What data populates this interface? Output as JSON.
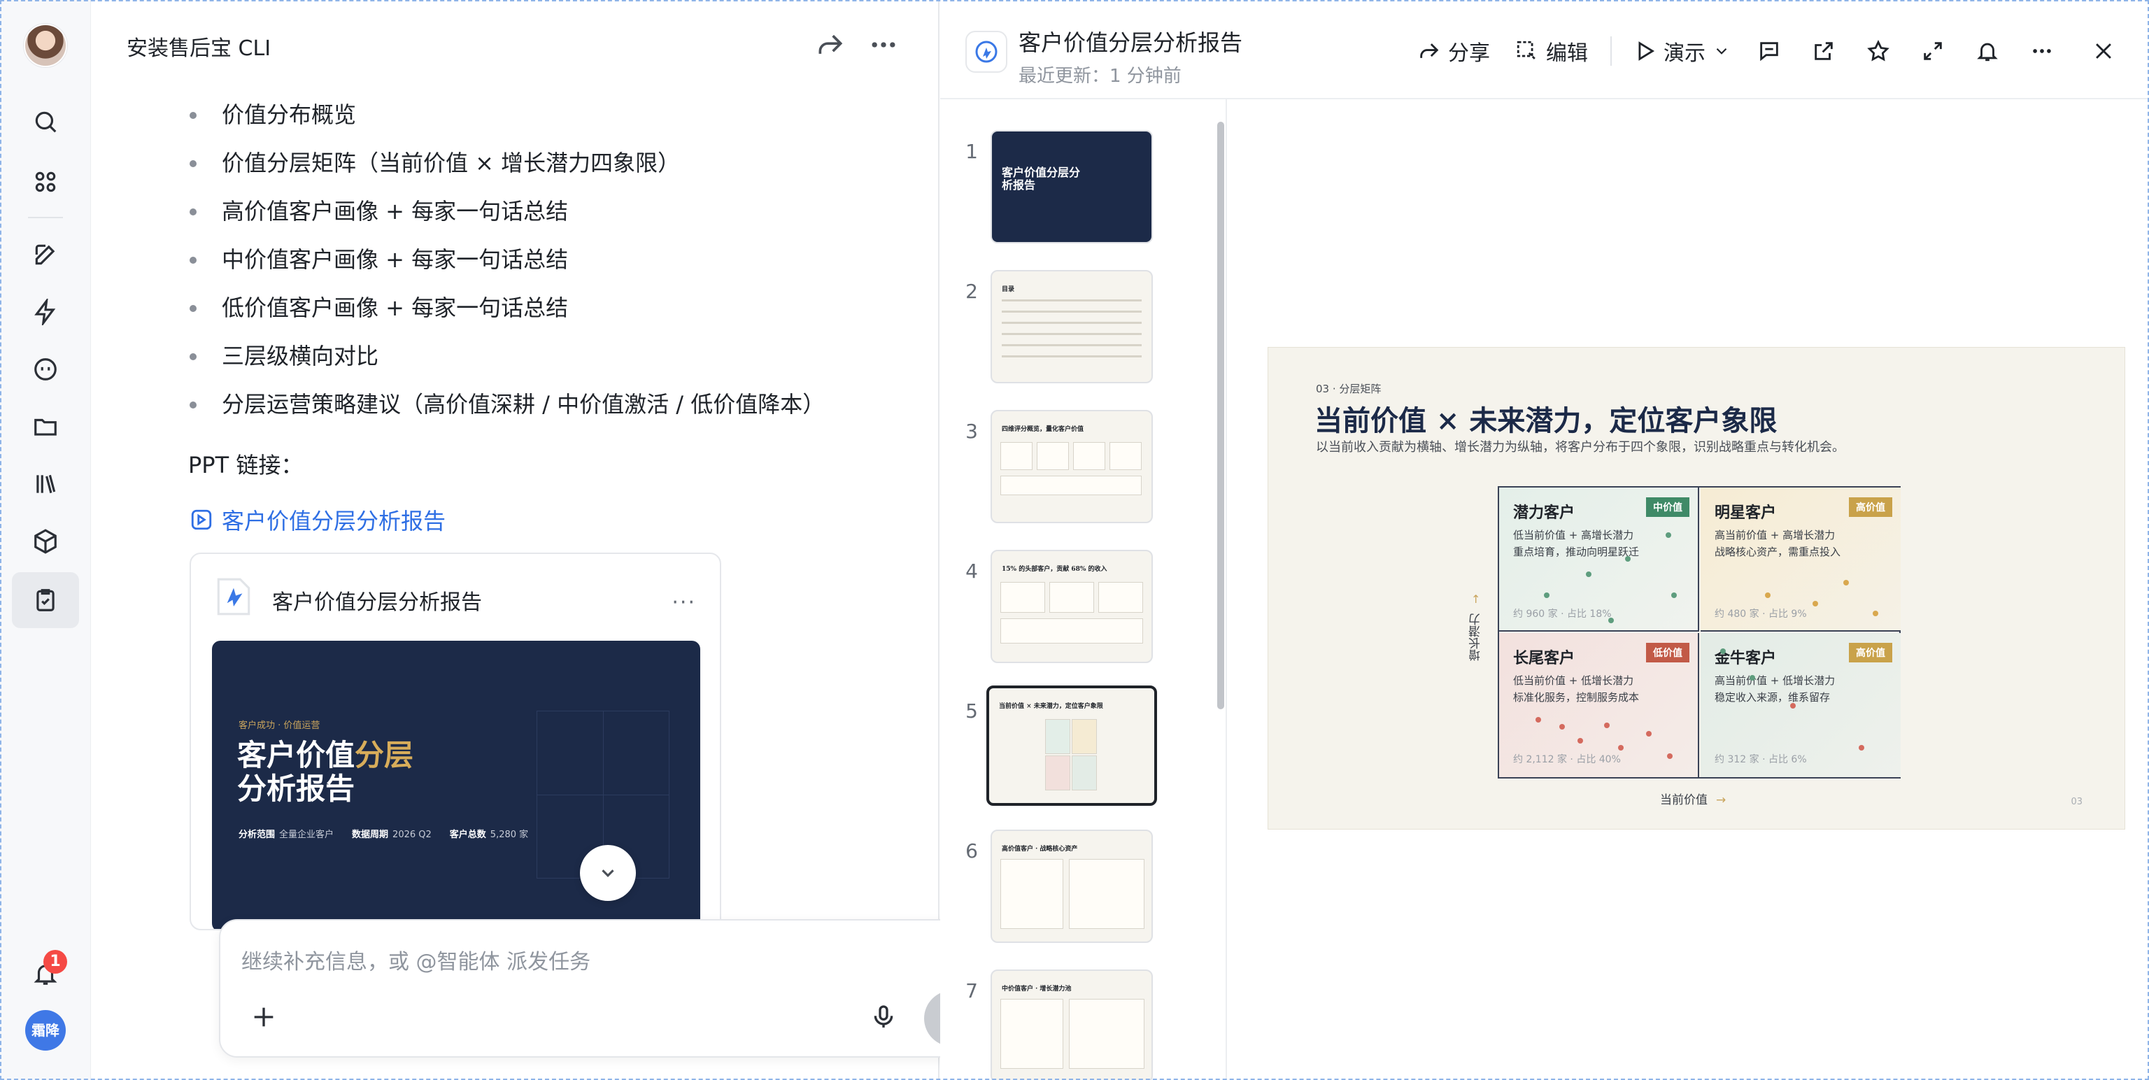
{
  "rail": {
    "notification_count": "1",
    "user_initials": "霜降"
  },
  "chat": {
    "title": "安装售后宝 CLI",
    "bullets": [
      "价值分布概览",
      "价值分层矩阵（当前价值 × 增长潜力四象限）",
      "高价值客户画像 + 每家一句话总结",
      "中价值客户画像 + 每家一句话总结",
      "低价值客户画像 + 每家一句话总结",
      "三层级横向对比",
      "分层运营策略建议（高价值深耕 / 中价值激活 / 低价值降本）"
    ],
    "ppt_label": "PPT 链接：",
    "ppt_link": "客户价值分层分析报告",
    "card": {
      "title": "客户价值分层分析报告",
      "more": "···",
      "cover_tag": "客户成功 · 价值运营",
      "cover_title_1": "客户价值",
      "cover_title_gold": "分层",
      "cover_title_2": "分析报告",
      "meta": [
        {
          "k": "分析范围",
          "v": "全量企业客户"
        },
        {
          "k": "数据周期",
          "v": "2026 Q2"
        },
        {
          "k": "客户总数",
          "v": "5,280 家"
        }
      ]
    },
    "composer_placeholder": "继续补充信息，或 @智能体 派发任务"
  },
  "panel": {
    "title": "客户价值分层分析报告",
    "subtitle": "最近更新：1 分钟前",
    "share_label": "分享",
    "edit_label": "编辑",
    "present_label": "演示",
    "thumbs": [
      {
        "num": "1",
        "label": "客户价值分层分析报告"
      },
      {
        "num": "2",
        "label": "目录"
      },
      {
        "num": "3",
        "label": "四维评分概览，量化客户价值"
      },
      {
        "num": "4",
        "label": "15% 的头部客户，贡献 68% 的收入"
      },
      {
        "num": "5",
        "label": "当前价值 × 未来潜力，定位客户象限"
      },
      {
        "num": "6",
        "label": "高价值客户 · 战略核心资产"
      },
      {
        "num": "7",
        "label": "中价值客户 · 增长潜力池"
      }
    ]
  },
  "slide": {
    "tag": "03 · 分层矩阵",
    "title": "当前价值 × 未来潜力，定位客户象限",
    "subtitle": "以当前收入贡献为横轴、增长潜力为纵轴，将客户分布于四个象限，识别战略重点与转化机会。",
    "y_label": "增长潜力",
    "x_label": "当前价值",
    "page": "03",
    "quadrants": [
      {
        "title": "潜力客户",
        "badge": "中价值",
        "badge_color": "#3f8a67",
        "desc": "低当前价值 + 高增长潜力\n重点培育，推动向明星跃迁",
        "stat": "约 960 家 · 占比 18%"
      },
      {
        "title": "明星客户",
        "badge": "高价值",
        "badge_color": "#c9a24a",
        "desc": "高当前价值 + 高增长潜力\n战略核心资产，需重点投入",
        "stat": "约 480 家 · 占比 9%"
      },
      {
        "title": "长尾客户",
        "badge": "低价值",
        "badge_color": "#c25a47",
        "desc": "低当前价值 + 低增长潜力\n标准化服务，控制服务成本",
        "stat": "约 2,112 家 · 占比 40%"
      },
      {
        "title": "金牛客户",
        "badge": "高价值",
        "badge_color": "#c9a24a",
        "desc": "高当前价值 + 低增长潜力\n稳定收入来源，维系留存",
        "stat": "约 312 家 · 占比 6%"
      }
    ]
  }
}
